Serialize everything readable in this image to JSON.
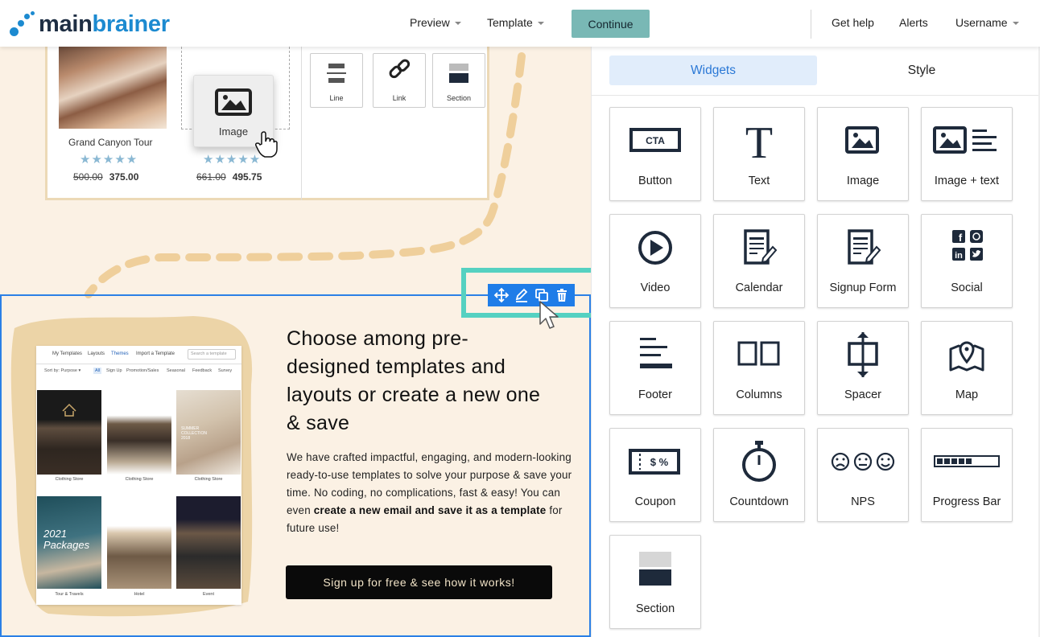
{
  "header": {
    "logo_main": "main",
    "logo_accent": "brainer",
    "nav": {
      "preview": "Preview",
      "template": "Template",
      "continue": "Continue",
      "get_help": "Get help",
      "alerts": "Alerts",
      "username": "Username"
    }
  },
  "canvas": {
    "prev_products": [
      {
        "name": "Grand Canyon Tour",
        "stars": "★★★★★",
        "old_price": "500.00",
        "price": "375.00"
      },
      {
        "name": "",
        "stars": "★★★★★",
        "old_price": "661.00",
        "price": "495.75"
      }
    ],
    "drag_widget_label": "Image",
    "mini_widgets": [
      "Line",
      "Link",
      "Section"
    ],
    "template_preview": {
      "tabs": [
        "My Templates",
        "Layouts",
        "Themes",
        "Import a Template"
      ],
      "search_placeholder": "Search a template",
      "filter_label": "Sort by: Purpose ▾",
      "filters": [
        "All",
        "Sign Up",
        "Promotion/Sales",
        "Seasonal",
        "Feedback",
        "Survey"
      ],
      "thumb_title": "SUMMER COLLECTION 2018",
      "packages_text": "2021 Packages",
      "captions": [
        "Clothing Store",
        "Clothing Store",
        "Clothing Store",
        "Tour & Travels",
        "Hotel",
        "Event"
      ]
    },
    "headline": "Choose among pre-designed templates and layouts or create a new one & save",
    "body_1": "We have crafted impactful, engaging, and modern-looking ready-to-use templates to solve your purpose & save your time. No coding, no complications, fast & easy! You can even ",
    "body_bold": "create a new email and save it as a template",
    "body_2": " for future use!",
    "cta": "Sign up for free & see how it works!",
    "toolbar_icons": [
      "move-icon",
      "edit-icon",
      "duplicate-icon",
      "delete-icon"
    ]
  },
  "panel": {
    "tabs": {
      "widgets": "Widgets",
      "style": "Style"
    },
    "widgets": [
      "Button",
      "Text",
      "Image",
      "Image + text",
      "Video",
      "Calendar",
      "Signup Form",
      "Social",
      "Footer",
      "Columns",
      "Spacer",
      "Map",
      "Coupon",
      "Countdown",
      "NPS",
      "Progress Bar",
      "Section"
    ],
    "button_icon_text": "CTA",
    "coupon_icon_text": "$ %",
    "text_icon_glyph": "T",
    "nps_faces": "☹😐☺"
  },
  "colors": {
    "accent_blue": "#2a78d6",
    "brand_dark": "#1e2e43",
    "brand_blue": "#1c8ad0",
    "continue_bg": "#79b8b5",
    "toolbar_bg": "#1f7de8",
    "highlight": "#55d1c1",
    "canvas_bg": "#fbf1e4"
  }
}
